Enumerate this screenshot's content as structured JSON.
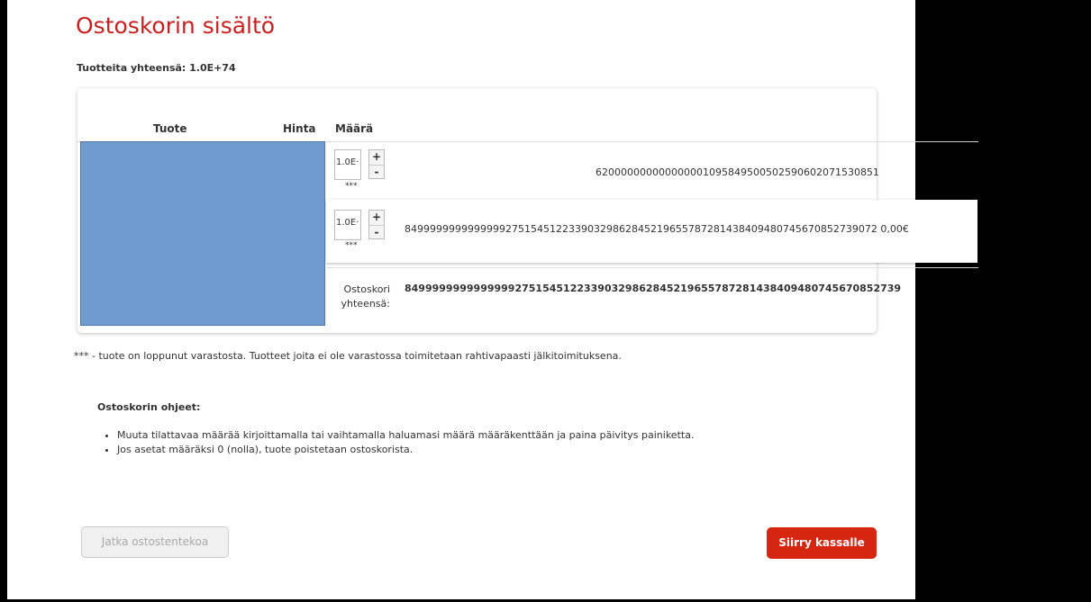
{
  "page": {
    "title": "Ostoskorin sisältö",
    "total_count": "Tuotteita yhteensä: 1.0E+74"
  },
  "table": {
    "headers": [
      "Tuote",
      "Hinta",
      "Määrä"
    ],
    "rows": [
      {
        "quantity": "1.0E·",
        "plus": "+",
        "minus": "-",
        "stars": "***",
        "value": "620000000000000001095849500502590602071530851"
      },
      {
        "quantity": "1.0E·",
        "plus": "+",
        "minus": "-",
        "stars": "***",
        "value": "849999999999999927515451223390329862845219655787281438409480745670852739072 0,00€"
      }
    ],
    "total_label": "Ostoskori yhteensä:",
    "total_value": "849999999999999927515451223390329862845219655787281438409480745670852739"
  },
  "note": "*** - tuote on loppunut varastosta. Tuotteet joita ei ole varastossa toimitetaan rahtivapaasti jälkitoimituksena.",
  "help": {
    "title": "Ostoskorin ohjeet:",
    "items": [
      "Muuta tilattavaa määrää kirjoittamalla tai vaihtamalla haluamasi määrä määräkenttään ja paina päivitys painiketta.",
      "Jos asetat määräksi 0 (nolla), tuote poistetaan ostoskorista."
    ]
  },
  "buttons": {
    "continue": "Jatka ostostentekoa",
    "checkout": "Siirry kassalle"
  },
  "colors": {
    "title": "#cc1f1f",
    "checkout_button": "#d62612",
    "product_image": "#6f9bd0"
  }
}
